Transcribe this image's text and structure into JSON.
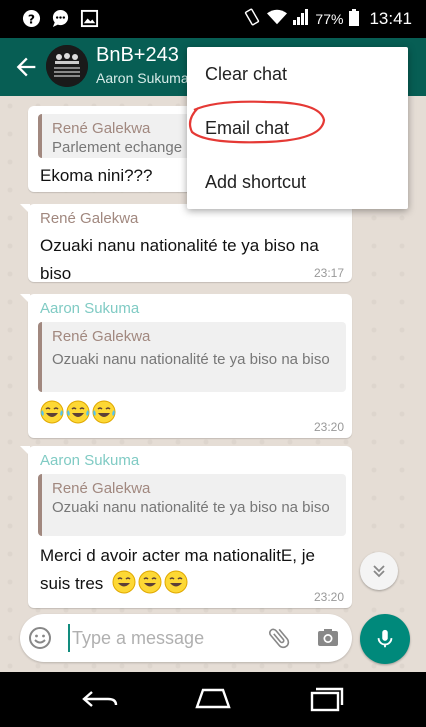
{
  "status_bar": {
    "battery": "77%",
    "time": "13:41",
    "icons": [
      "help-circle-icon",
      "chat-bubble-icon",
      "image-icon",
      "vibrate-icon",
      "wifi-icon",
      "signal-icon",
      "battery-icon"
    ]
  },
  "header": {
    "title": "BnB+243",
    "subtitle": "Aaron Sukuma",
    "accent": "#075e54"
  },
  "menu": {
    "items": [
      {
        "label": "Clear chat"
      },
      {
        "label": "Email chat"
      },
      {
        "label": "Add shortcut"
      }
    ],
    "highlight_color": "#e53935"
  },
  "messages": [
    {
      "quote_name": "René Galekwa",
      "quote_text": "Parlement echange",
      "text": "Ekoma nini???",
      "time": ""
    },
    {
      "sender": "René Galekwa",
      "sender_color": "#a1887f",
      "text": "Ozuaki nanu nationalité te ya biso na biso",
      "time": "23:17"
    },
    {
      "sender": "Aaron Sukuma",
      "sender_color": "#80cbc4",
      "quote_name": "René Galekwa",
      "quote_text": "Ozuaki nanu nationalité te ya biso na biso",
      "emojis": [
        "tears-of-joy-icon",
        "tears-of-joy-icon",
        "tears-of-joy-icon"
      ],
      "time": "23:20"
    },
    {
      "sender": "Aaron Sukuma",
      "sender_color": "#80cbc4",
      "quote_name": "René Galekwa",
      "quote_text": "Ozuaki nanu nationalité te ya biso na biso",
      "text": "Merci d avoir acter ma nationalitE, je suis tres",
      "emojis": [
        "smiling-face-icon",
        "smiling-face-icon",
        "smiling-face-icon"
      ],
      "time": "23:20"
    }
  ],
  "composer": {
    "placeholder": "Type a message"
  }
}
